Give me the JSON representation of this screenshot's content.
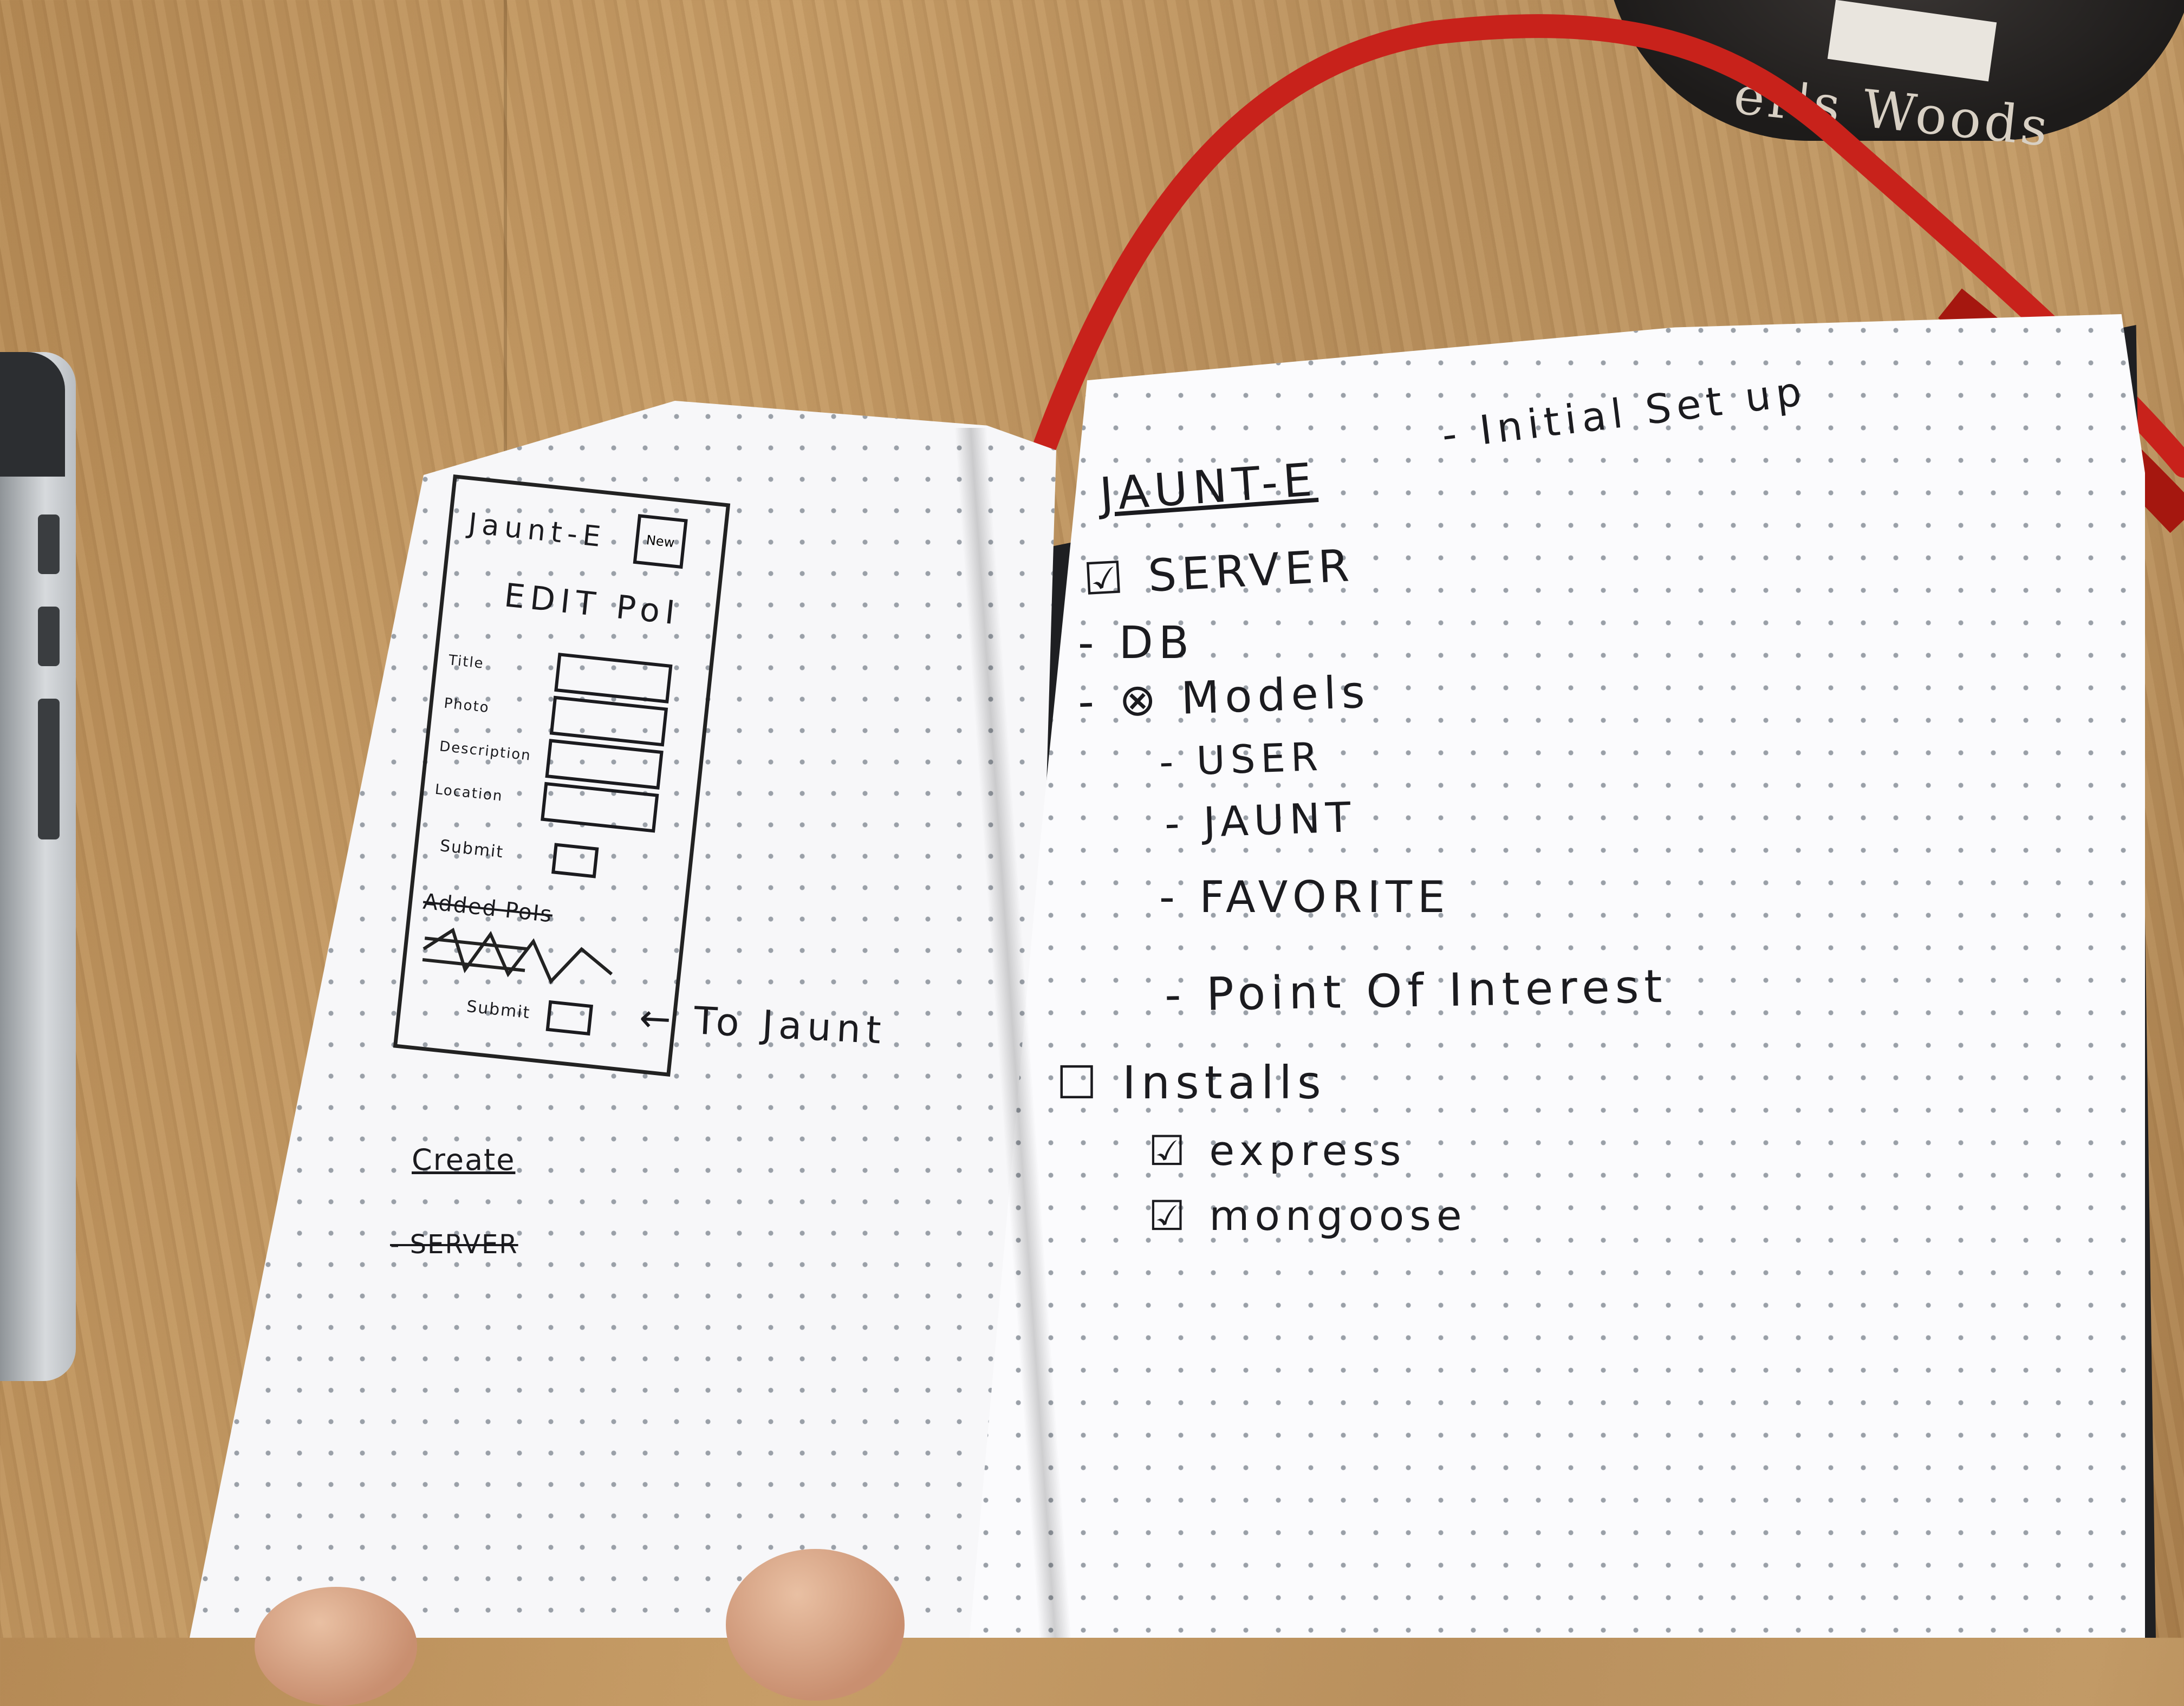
{
  "notebook": {
    "right_page": {
      "title": "JAUNT-E",
      "subtitle": "- Initial Set up",
      "items": [
        {
          "mark": "☑",
          "text": "SERVER"
        },
        {
          "mark": "-",
          "text": "DB"
        },
        {
          "mark": "- ⊗",
          "text": "Models"
        },
        {
          "mark": "-",
          "text": "USER"
        },
        {
          "mark": "-",
          "text": "JAUNT"
        },
        {
          "mark": "-",
          "text": "FAVORITE"
        },
        {
          "mark": "-",
          "text": "Point Of Interest"
        },
        {
          "mark": "☐",
          "text": "Installs"
        },
        {
          "mark": "☑",
          "text": "express"
        },
        {
          "mark": "☑",
          "text": "mongoose"
        }
      ]
    },
    "left_page": {
      "wireframe_title": "Jaunt-E",
      "wireframe_button": "New",
      "wireframe_heading": "EDIT PoI",
      "fields": [
        "Title",
        "Photo",
        "Description",
        "Location"
      ],
      "submit_label": "Submit",
      "pois_label": "Added PoIs",
      "bottom_submit_label": "Submit",
      "arrow_note": "← To Jaunt",
      "create_heading": "Create",
      "create_item": "- SERVER"
    }
  },
  "mug": {
    "text": "er's Woods"
  }
}
